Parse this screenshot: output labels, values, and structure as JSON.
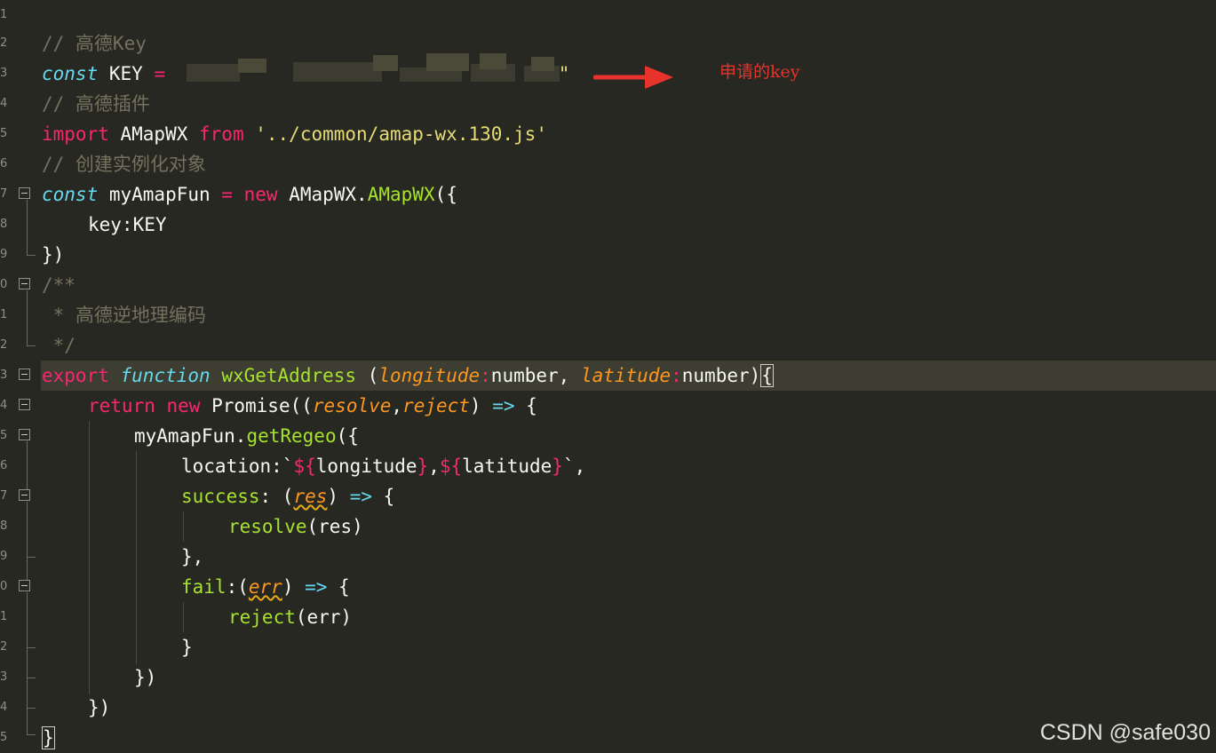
{
  "gutter": {
    "line_numbers": [
      "1",
      "2",
      "3",
      "4",
      "5",
      "6",
      "7",
      "8",
      "9",
      "0",
      "1",
      "2",
      "3",
      "4",
      "5",
      "6",
      "7",
      "8",
      "9",
      "0",
      "1",
      "2",
      "3",
      "4",
      "5"
    ]
  },
  "code": {
    "l2": {
      "comment": "// 高德Key"
    },
    "l3": {
      "kw": "const",
      "name": " KEY ",
      "op": "=",
      "sp": " ",
      "quote": "\""
    },
    "l4": {
      "comment": "// 高德插件"
    },
    "l5": {
      "kw": "import",
      "name": " AMapWX ",
      "from": "from",
      "sp": " ",
      "str": "'../common/amap-wx.130.js'"
    },
    "l6": {
      "comment": "// 创建实例化对象"
    },
    "l7": {
      "kw": "const",
      "name": " myAmapFun ",
      "op": "=",
      "sp": " ",
      "new": "new",
      "cls": " AMapWX.",
      "fn": "AMapWX",
      "tail": "({"
    },
    "l8": {
      "text": "key:KEY"
    },
    "l9": {
      "text": "})"
    },
    "l10": {
      "text": "/**"
    },
    "l11": {
      "text": " * 高德逆地理编码"
    },
    "l12": {
      "text": " */"
    },
    "l13": {
      "kw": "export",
      "sp1": " ",
      "fkw": "function",
      "sp2": " ",
      "fn": "wxGetAddress",
      "open": " (",
      "p1": "longitude",
      "c1": ":",
      "t1": "number, ",
      "p2": "latitude",
      "c2": ":",
      "t2": "number)",
      "brace": "{"
    },
    "l14": {
      "ret": "return",
      "sp": " ",
      "new": "new",
      "promise": " Promise((",
      "p1": "resolve",
      "comma": ",",
      "p2": "reject",
      "close": ") ",
      "arrow": "=>",
      "brace": " {"
    },
    "l15": {
      "obj": "myAmapFun.",
      "fn": "getRegeo",
      "tail": "({"
    },
    "l16": {
      "key": "location:`",
      "i1o": "${",
      "v1": "longitude",
      "i1c": "}",
      "comma": ",",
      "i2o": "${",
      "v2": "latitude",
      "i2c": "}",
      "end": "`,"
    },
    "l17": {
      "fn": "success",
      "colon": ": (",
      "p": "res",
      "close": ") ",
      "arrow": "=>",
      "brace": " {"
    },
    "l18": {
      "fn": "resolve",
      "tail": "(res)"
    },
    "l19": {
      "text": "},"
    },
    "l20": {
      "fn": "fail",
      "colon": ":(",
      "p": "err",
      "close": ") ",
      "arrow": "=>",
      "brace": " {"
    },
    "l21": {
      "fn": "reject",
      "tail": "(err)"
    },
    "l22": {
      "text": "}"
    },
    "l23": {
      "text": "})"
    },
    "l24": {
      "text": "})"
    },
    "l25": {
      "text": "}"
    }
  },
  "annotation": {
    "text": "申请的key",
    "color": "#e8322c"
  },
  "watermark": {
    "text": "CSDN @safe030"
  },
  "colors": {
    "background": "#272822",
    "comment": "#75715e",
    "keyword": "#f92672",
    "storage": "#66d9ef",
    "function": "#a6e22e",
    "string": "#e6db74",
    "parameter": "#fd971f"
  }
}
